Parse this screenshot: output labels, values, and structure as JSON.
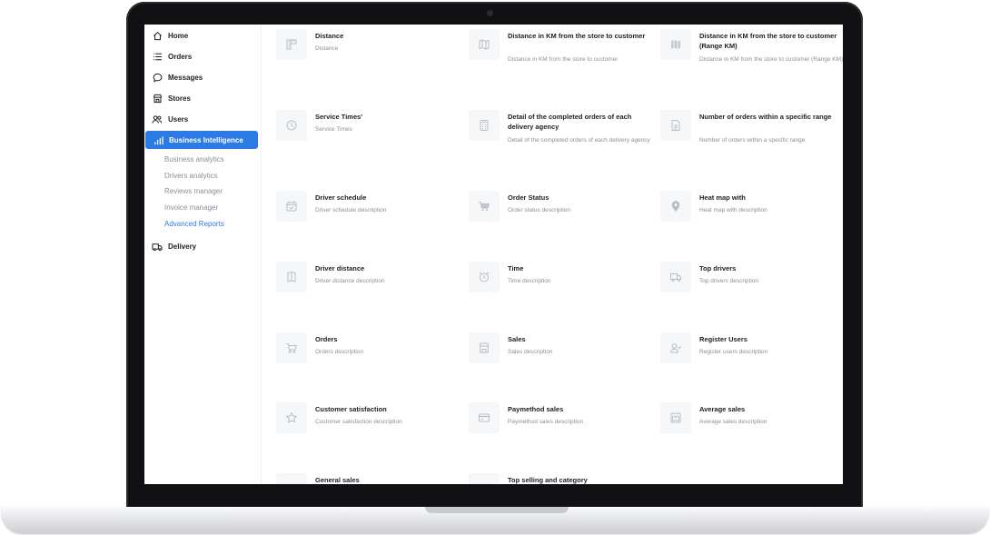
{
  "sidebar": {
    "items": [
      {
        "label": "Home",
        "icon": "home-icon"
      },
      {
        "label": "Orders",
        "icon": "list-icon"
      },
      {
        "label": "Messages",
        "icon": "chat-bubble-icon"
      },
      {
        "label": "Stores",
        "icon": "store-icon"
      },
      {
        "label": "Users",
        "icon": "users-icon"
      },
      {
        "label": "Business Intelligence",
        "icon": "bar-chart-icon",
        "active": true
      }
    ],
    "sub_items": [
      {
        "label": "Business analytics"
      },
      {
        "label": "Drivers analytics"
      },
      {
        "label": "Reviews manager"
      },
      {
        "label": "Invoice manager"
      },
      {
        "label": "Advanced Reports",
        "active": true
      }
    ],
    "delivery": {
      "label": "Delivery",
      "icon": "truck-icon"
    }
  },
  "reports": [
    {
      "title": "Distance",
      "desc": "Distance",
      "icon": "ruler-icon"
    },
    {
      "title": "Distance in KM from the store to customer",
      "desc": "Distance in KM from the store to customer",
      "icon": "map-icon"
    },
    {
      "title": "Distance in KM from the store to customer (Range KM)",
      "desc": "Distance in KM from the store to customer (Range KM)",
      "icon": "map-icon"
    },
    {
      "title": "Service Times'",
      "desc": "Service Times",
      "icon": "clock-icon"
    },
    {
      "title": "Detail of the completed orders of each delivery agency",
      "desc": "Detail of the completed orders of each delivery agency",
      "icon": "calculator-icon"
    },
    {
      "title": "Number of orders within a specific range",
      "desc": "Number of orders within a specific range",
      "icon": "document-icon"
    },
    {
      "title": "Driver schedule",
      "desc": "Driver schedule description",
      "icon": "calendar-check-icon"
    },
    {
      "title": "Order Status",
      "desc": "Order status description",
      "icon": "cart-icon"
    },
    {
      "title": "Heat map with",
      "desc": "Heat map with description",
      "icon": "map-pin-icon"
    },
    {
      "title": "Driver distance",
      "desc": "Driver distance description",
      "icon": "map-icon"
    },
    {
      "title": "Time",
      "desc": "Time description",
      "icon": "alarm-clock-icon"
    },
    {
      "title": "Top drivers",
      "desc": "Top drivers description",
      "icon": "truck-icon"
    },
    {
      "title": "Orders",
      "desc": "Orders description",
      "icon": "cart-icon"
    },
    {
      "title": "Sales",
      "desc": "Sales description",
      "icon": "store-icon"
    },
    {
      "title": "Register Users",
      "desc": "Register users description",
      "icon": "user-check-icon"
    },
    {
      "title": "Customer satisfaction",
      "desc": "Customer satisfaction description",
      "icon": "star-icon"
    },
    {
      "title": "Paymethod sales",
      "desc": "Paymethod sales description",
      "icon": "credit-card-icon"
    },
    {
      "title": "Average sales",
      "desc": "Average sales description",
      "icon": "shop-window-icon"
    },
    {
      "title": "General sales",
      "desc": "",
      "icon": "cart-icon"
    },
    {
      "title": "Top selling and category",
      "desc": "",
      "icon": "tag-icon"
    }
  ],
  "colors": {
    "accent": "#2c7be5",
    "text": "#1e1f24",
    "muted": "#8a8f9a",
    "icon_bg": "#f6f7f9",
    "icon": "#b9bdc6"
  }
}
